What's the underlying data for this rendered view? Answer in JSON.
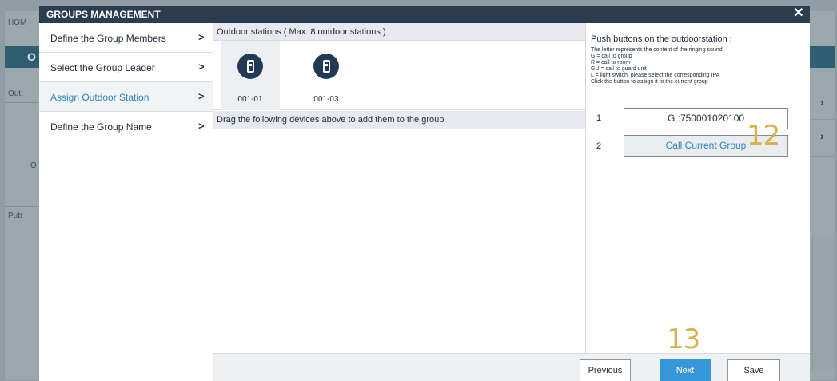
{
  "background": {
    "home_label": "HOM",
    "header_letter": "O",
    "out_label": "Out",
    "o_label": "O",
    "pub_label": "Pub",
    "chevron": "›"
  },
  "dialog": {
    "title": "GROUPS MANAGEMENT",
    "close_glyph": "✕"
  },
  "menu": {
    "items": [
      {
        "label": "Define the Group Members",
        "active": false
      },
      {
        "label": "Select the Group Leader",
        "active": false
      },
      {
        "label": "Assign Outdoor Station",
        "active": true
      },
      {
        "label": "Define the Group Name",
        "active": false
      }
    ],
    "chevron": ">"
  },
  "stations_panel": {
    "header": "Outdoor stations ( Max. 8 outdoor stations )",
    "stations": [
      {
        "label": "001-01",
        "selected": true,
        "icon": "outdoor-station-icon"
      },
      {
        "label": "001-03",
        "selected": false,
        "icon": "outdoor-station-icon"
      }
    ],
    "drag_hint": "Drag the following devices above to add them to the group"
  },
  "push_buttons": {
    "title": "Push buttons on the outdoorstation :",
    "lines": [
      "The letter represents the content of the ringing sound",
      "G = call to group",
      "R = call to room",
      "GU = call to guard unit",
      "L = light switch, please select the corresponding IPA",
      "Click the button to assign it to the current group"
    ],
    "buttons": [
      {
        "number": "1",
        "label": "G :750001020100"
      },
      {
        "number": "2",
        "label": "Call Current Group"
      }
    ]
  },
  "footer": {
    "previous_label": "Previous",
    "next_label": "Next",
    "save_label": "Save"
  },
  "annotations": {
    "step_12": "12",
    "step_13": "13"
  },
  "colors": {
    "title_bar": "#2b3d4f",
    "accent_blue": "#2d85c5",
    "next_button": "#3597d8",
    "annotation": "#d9b14a",
    "station_icon": "#223a53"
  }
}
